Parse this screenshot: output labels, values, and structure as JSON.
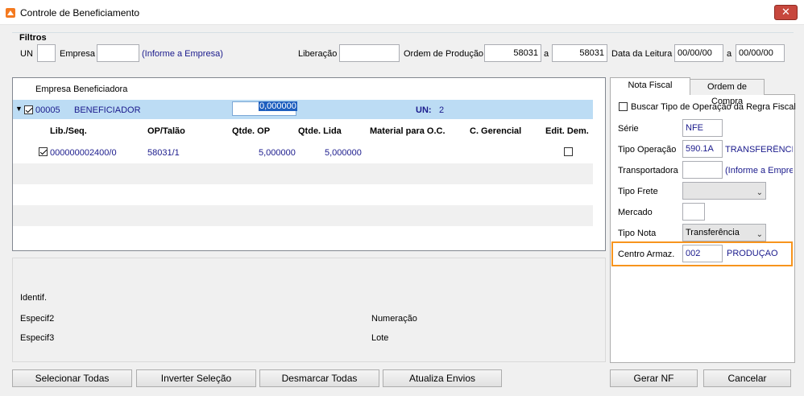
{
  "window": {
    "title": "Controle de Beneficiamento",
    "close_glyph": "✕"
  },
  "filtros": {
    "title": "Filtros",
    "un_label": "UN",
    "un_value": "",
    "empresa_label": "Empresa",
    "empresa_value": "",
    "empresa_hint": "(Informe a Empresa)",
    "liberacao_label": "Liberação",
    "liberacao_value": "",
    "ordem_label": "Ordem de Produção",
    "ordem_from": "58031",
    "ordem_sep": "a",
    "ordem_to": "58031",
    "data_label": "Data da Leitura",
    "data_from": "00/00/00",
    "data_sep": "a",
    "data_to": "00/00/00"
  },
  "grid": {
    "group_header": "Empresa Beneficiadora",
    "group": {
      "code": "00005",
      "name": "BENEFICIADOR",
      "total": "0,000000",
      "un_label": "UN:",
      "un_value": "2"
    },
    "columns": [
      "Lib./Seq.",
      "OP/Talão",
      "Qtde. OP",
      "Qtde. Lida",
      "Material para O.C.",
      "C. Gerencial",
      "Edit. Dem."
    ],
    "rows": [
      {
        "lib_seq": "000000002400/0",
        "op_talao": "58031/1",
        "qtde_op": "5,000000",
        "qtde_lida": "5,000000",
        "material": "",
        "c_gerencial": "",
        "checked": true,
        "edit_dem": false
      }
    ]
  },
  "info": {
    "identif": "Identif.",
    "especif2": "Especif2",
    "especif3": "Especif3",
    "numeracao": "Numeração",
    "lote": "Lote"
  },
  "tabs": {
    "nota_fiscal": "Nota Fiscal",
    "ordem_compra": "Ordem de Compra"
  },
  "nota_fiscal": {
    "buscar_label": "Buscar Tipo de Operação da Regra Fiscal",
    "serie_label": "Série",
    "serie_value": "NFE",
    "tipo_operacao_label": "Tipo Operação",
    "tipo_operacao_value": "590.1A",
    "tipo_operacao_desc": "TRANSFERÊNCIA",
    "transportadora_label": "Transportadora",
    "transportadora_value": "",
    "transportadora_hint": "(Informe a Empre",
    "tipo_frete_label": "Tipo Frete",
    "tipo_frete_value": "",
    "mercado_label": "Mercado",
    "mercado_value": "",
    "tipo_nota_label": "Tipo Nota",
    "tipo_nota_value": "Transferência",
    "centro_label": "Centro Armaz.",
    "centro_value": "002",
    "centro_desc": "PRODUÇAO"
  },
  "buttons": {
    "selecionar": "Selecionar Todas",
    "inverter": "Inverter Seleção",
    "desmarcar": "Desmarcar Todas",
    "atualiza": "Atualiza Envios",
    "gerar": "Gerar NF",
    "cancelar": "Cancelar"
  },
  "colors": {
    "highlight": "#f7941d",
    "selection": "#bcdcf4",
    "link_text": "#1a1a8c",
    "close_red": "#c7473d"
  }
}
